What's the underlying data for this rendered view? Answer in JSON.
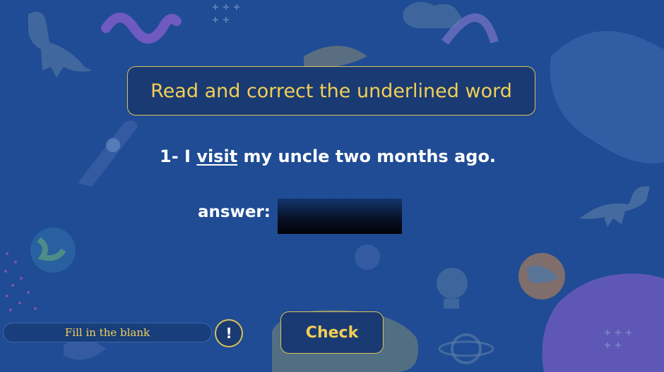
{
  "question": {
    "title": "Read and correct the underlined word",
    "number": "1- I",
    "underlined_word": "visit",
    "rest": "my uncle two months ago."
  },
  "answer": {
    "label": "answer:",
    "value": ""
  },
  "footer": {
    "hint_text": "Fill in the blank",
    "info_label": "!",
    "check_label": "Check"
  },
  "colors": {
    "background": "#1f4c94",
    "accent": "#f2cf55",
    "panel": "#1a3a73"
  },
  "icons": [
    "dinosaur-icon",
    "rocket-icon",
    "rainbow-icon",
    "planet-icon",
    "lightbulb-icon",
    "gear-icon",
    "leaf-icon",
    "sparkles-icon"
  ]
}
